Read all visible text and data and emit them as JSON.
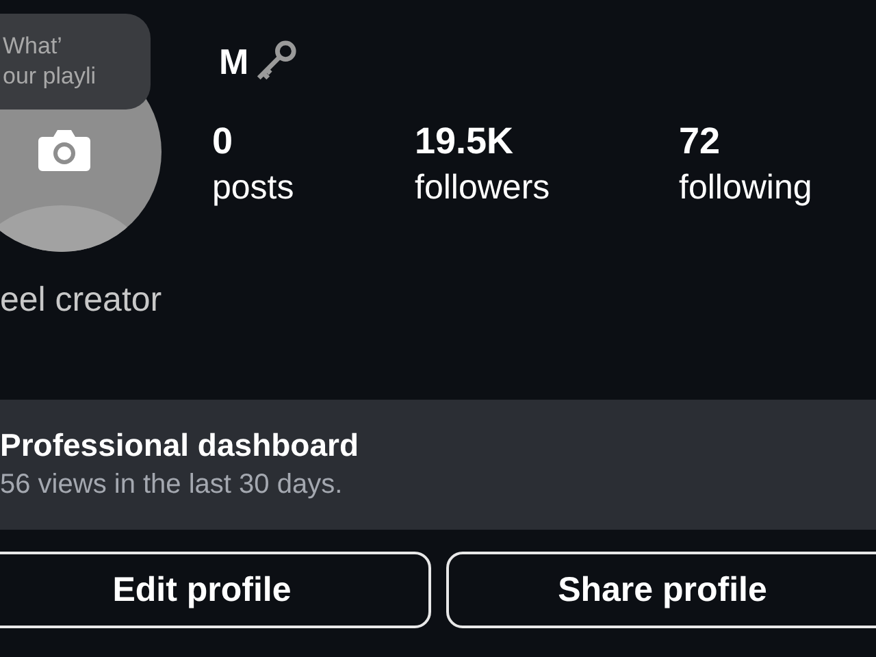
{
  "profile": {
    "name": "M",
    "note": [
      "What’",
      "our playli"
    ],
    "category": "eel creator"
  },
  "stats": [
    {
      "value": "0",
      "label": "posts"
    },
    {
      "value": "19.5K",
      "label": "followers"
    },
    {
      "value": "72",
      "label": "following"
    }
  ],
  "dashboard": {
    "title": "Professional dashboard",
    "subtitle": "56 views in the last 30 days."
  },
  "buttons": [
    "Edit profile",
    "Share profile"
  ]
}
